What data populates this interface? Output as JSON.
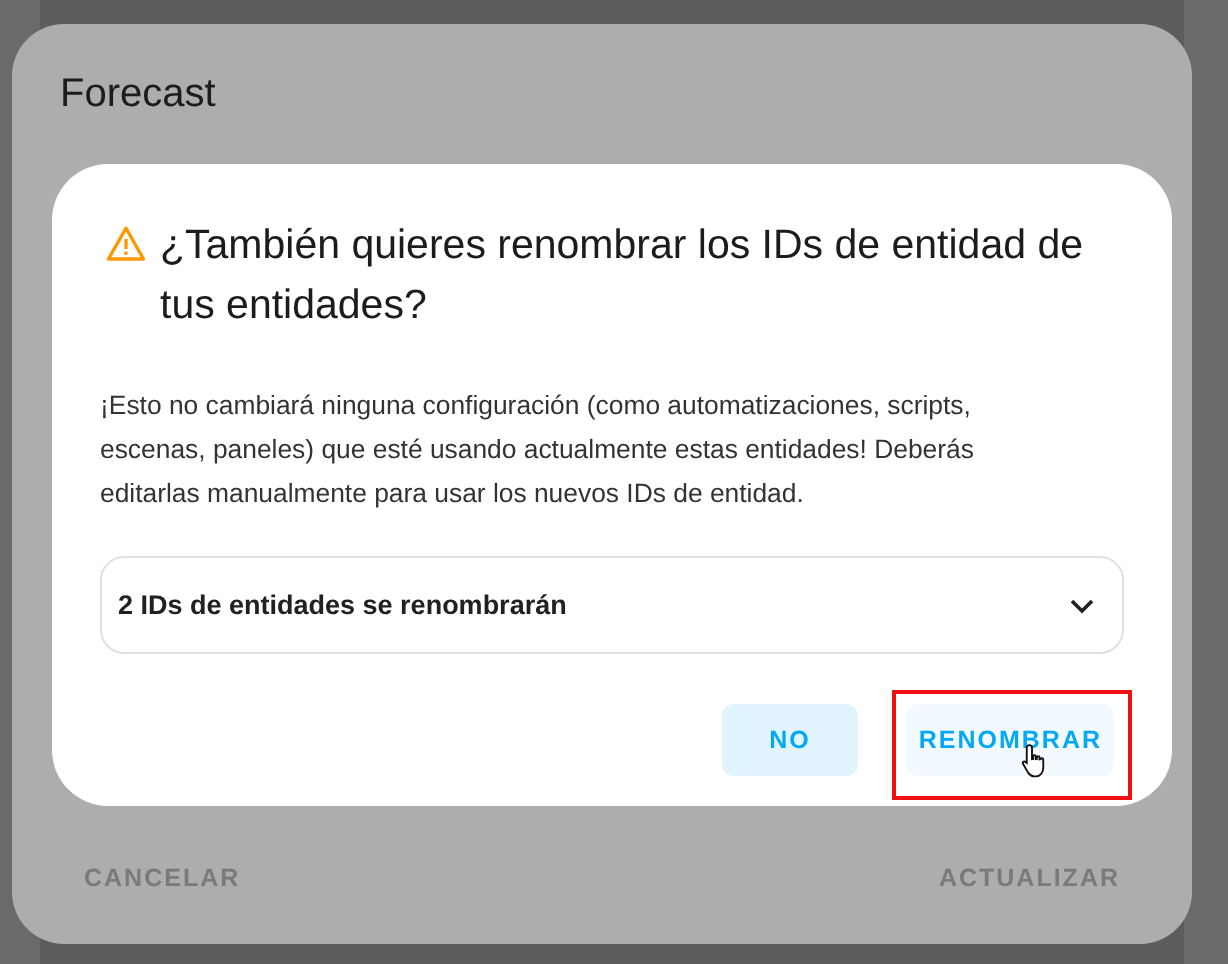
{
  "outer_dialog": {
    "title": "Forecast",
    "buttons": [
      {
        "label": "CANCELAR"
      },
      {
        "label": "ACTUALIZAR"
      }
    ]
  },
  "confirm_dialog": {
    "title": "¿También quieres renombrar los IDs de entidad de tus entidades?",
    "message": "¡Esto no cambiará ninguna configuración (como automatizaciones, scripts, escenas, paneles) que esté usando actualmente estas entidades! Deberás editarlas manualmente para usar los nuevos IDs de entidad.",
    "expander": {
      "label": "2 IDs de entidades se renombrarán",
      "expanded": false
    },
    "actions": [
      {
        "label": "NO",
        "kind": "tonal",
        "highlighted": false
      },
      {
        "label": "RENOMBRAR",
        "kind": "text",
        "highlighted": true
      }
    ]
  }
}
